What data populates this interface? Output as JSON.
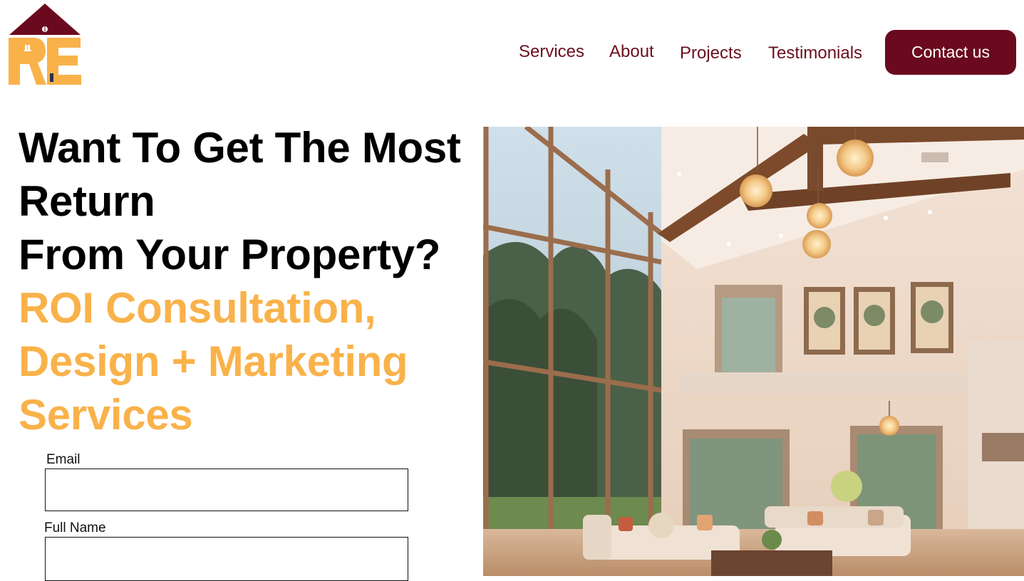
{
  "logo": {
    "letters": "RE"
  },
  "nav": {
    "links": [
      "Services",
      "About",
      "Projects",
      "Testimonials"
    ],
    "cta": "Contact us"
  },
  "hero": {
    "headline_lines": [
      "Want To Get The Most",
      "Return",
      "From Your Property?"
    ],
    "subheadline_lines": [
      "ROI Consultation,",
      "Design + Marketing",
      "Services"
    ]
  },
  "form": {
    "email_label": "Email",
    "email_value": "",
    "fullname_label": "Full Name",
    "fullname_value": ""
  },
  "image": {
    "icon": "interior-living-room-photo"
  },
  "colors": {
    "brand": "#6b0a1e",
    "accent": "#f9b24a",
    "text": "#000000",
    "background": "#ffffff"
  }
}
